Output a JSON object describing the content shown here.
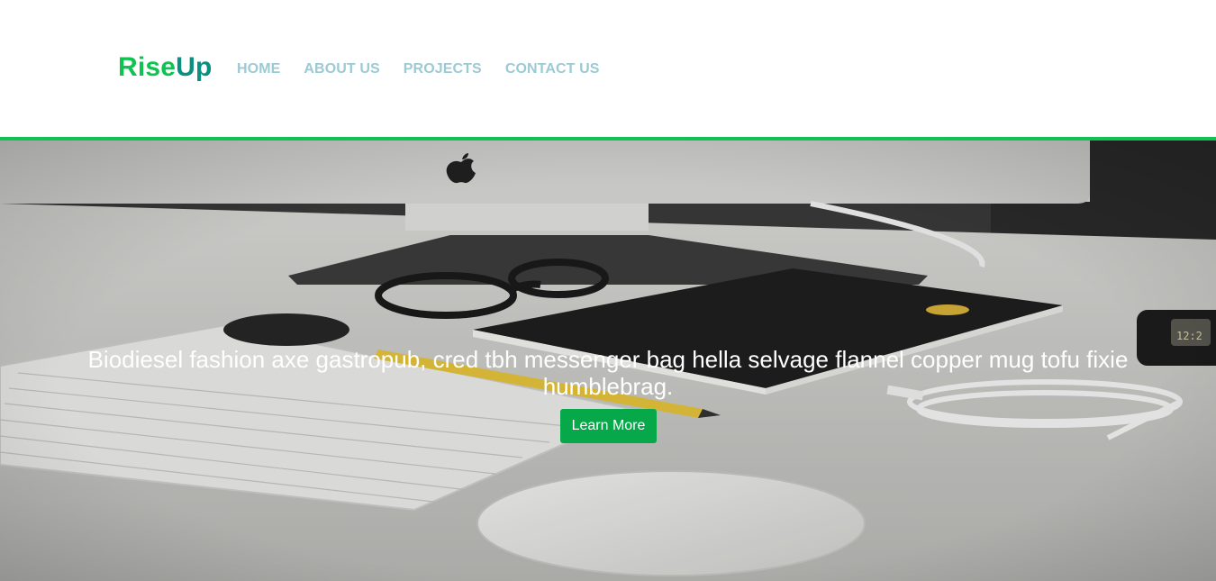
{
  "brand": {
    "name_part_1": "Rise",
    "name_part_2": "Up",
    "color_primary": "#10c350",
    "color_secondary": "#0a8f80"
  },
  "nav": {
    "items": [
      {
        "label": "HOME"
      },
      {
        "label": "ABOUT US"
      },
      {
        "label": "PROJECTS"
      },
      {
        "label": "CONTACT US"
      }
    ],
    "link_color": "#9ccad4"
  },
  "hero": {
    "headline": "Biodiesel fashion axe gastropub, cred tbh messenger bag hella selvage flannel copper mug tofu fixie humblebrag.",
    "cta_label": "Learn More",
    "cta_color": "#06a84a",
    "image_description_icons": [
      "apple-logo-icon",
      "keyboard-icon",
      "mouse-icon",
      "glasses-icon",
      "notebook-icon",
      "pencil-icon",
      "cable-icon",
      "watch-icon"
    ]
  },
  "accent_bar_color": "#10c350"
}
